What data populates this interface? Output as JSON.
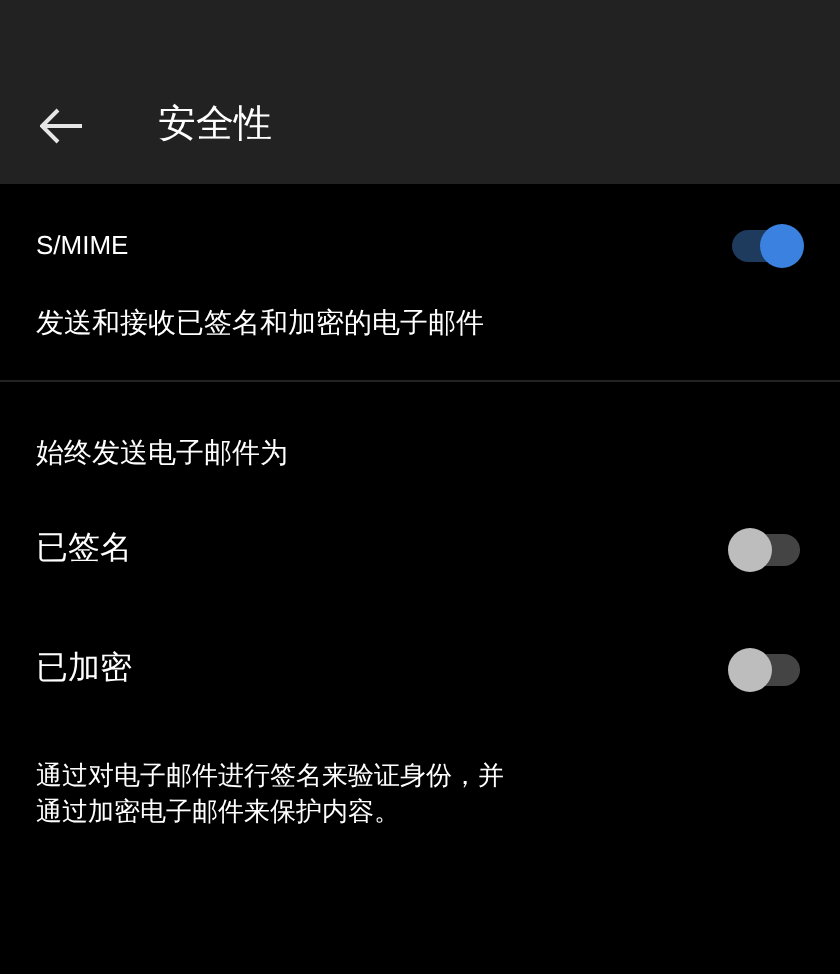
{
  "header": {
    "title": "安全性"
  },
  "smime": {
    "label": "S/MIME",
    "on": true,
    "description": "发送和接收已签名和加密的电子邮件"
  },
  "always_send": {
    "heading": "始终发送电子邮件为",
    "options": [
      {
        "label": "已签名",
        "on": false
      },
      {
        "label": "已加密",
        "on": false
      }
    ]
  },
  "footnote": "通过对电子邮件进行签名来验证身份，并通过加密电子邮件来保护内容。"
}
